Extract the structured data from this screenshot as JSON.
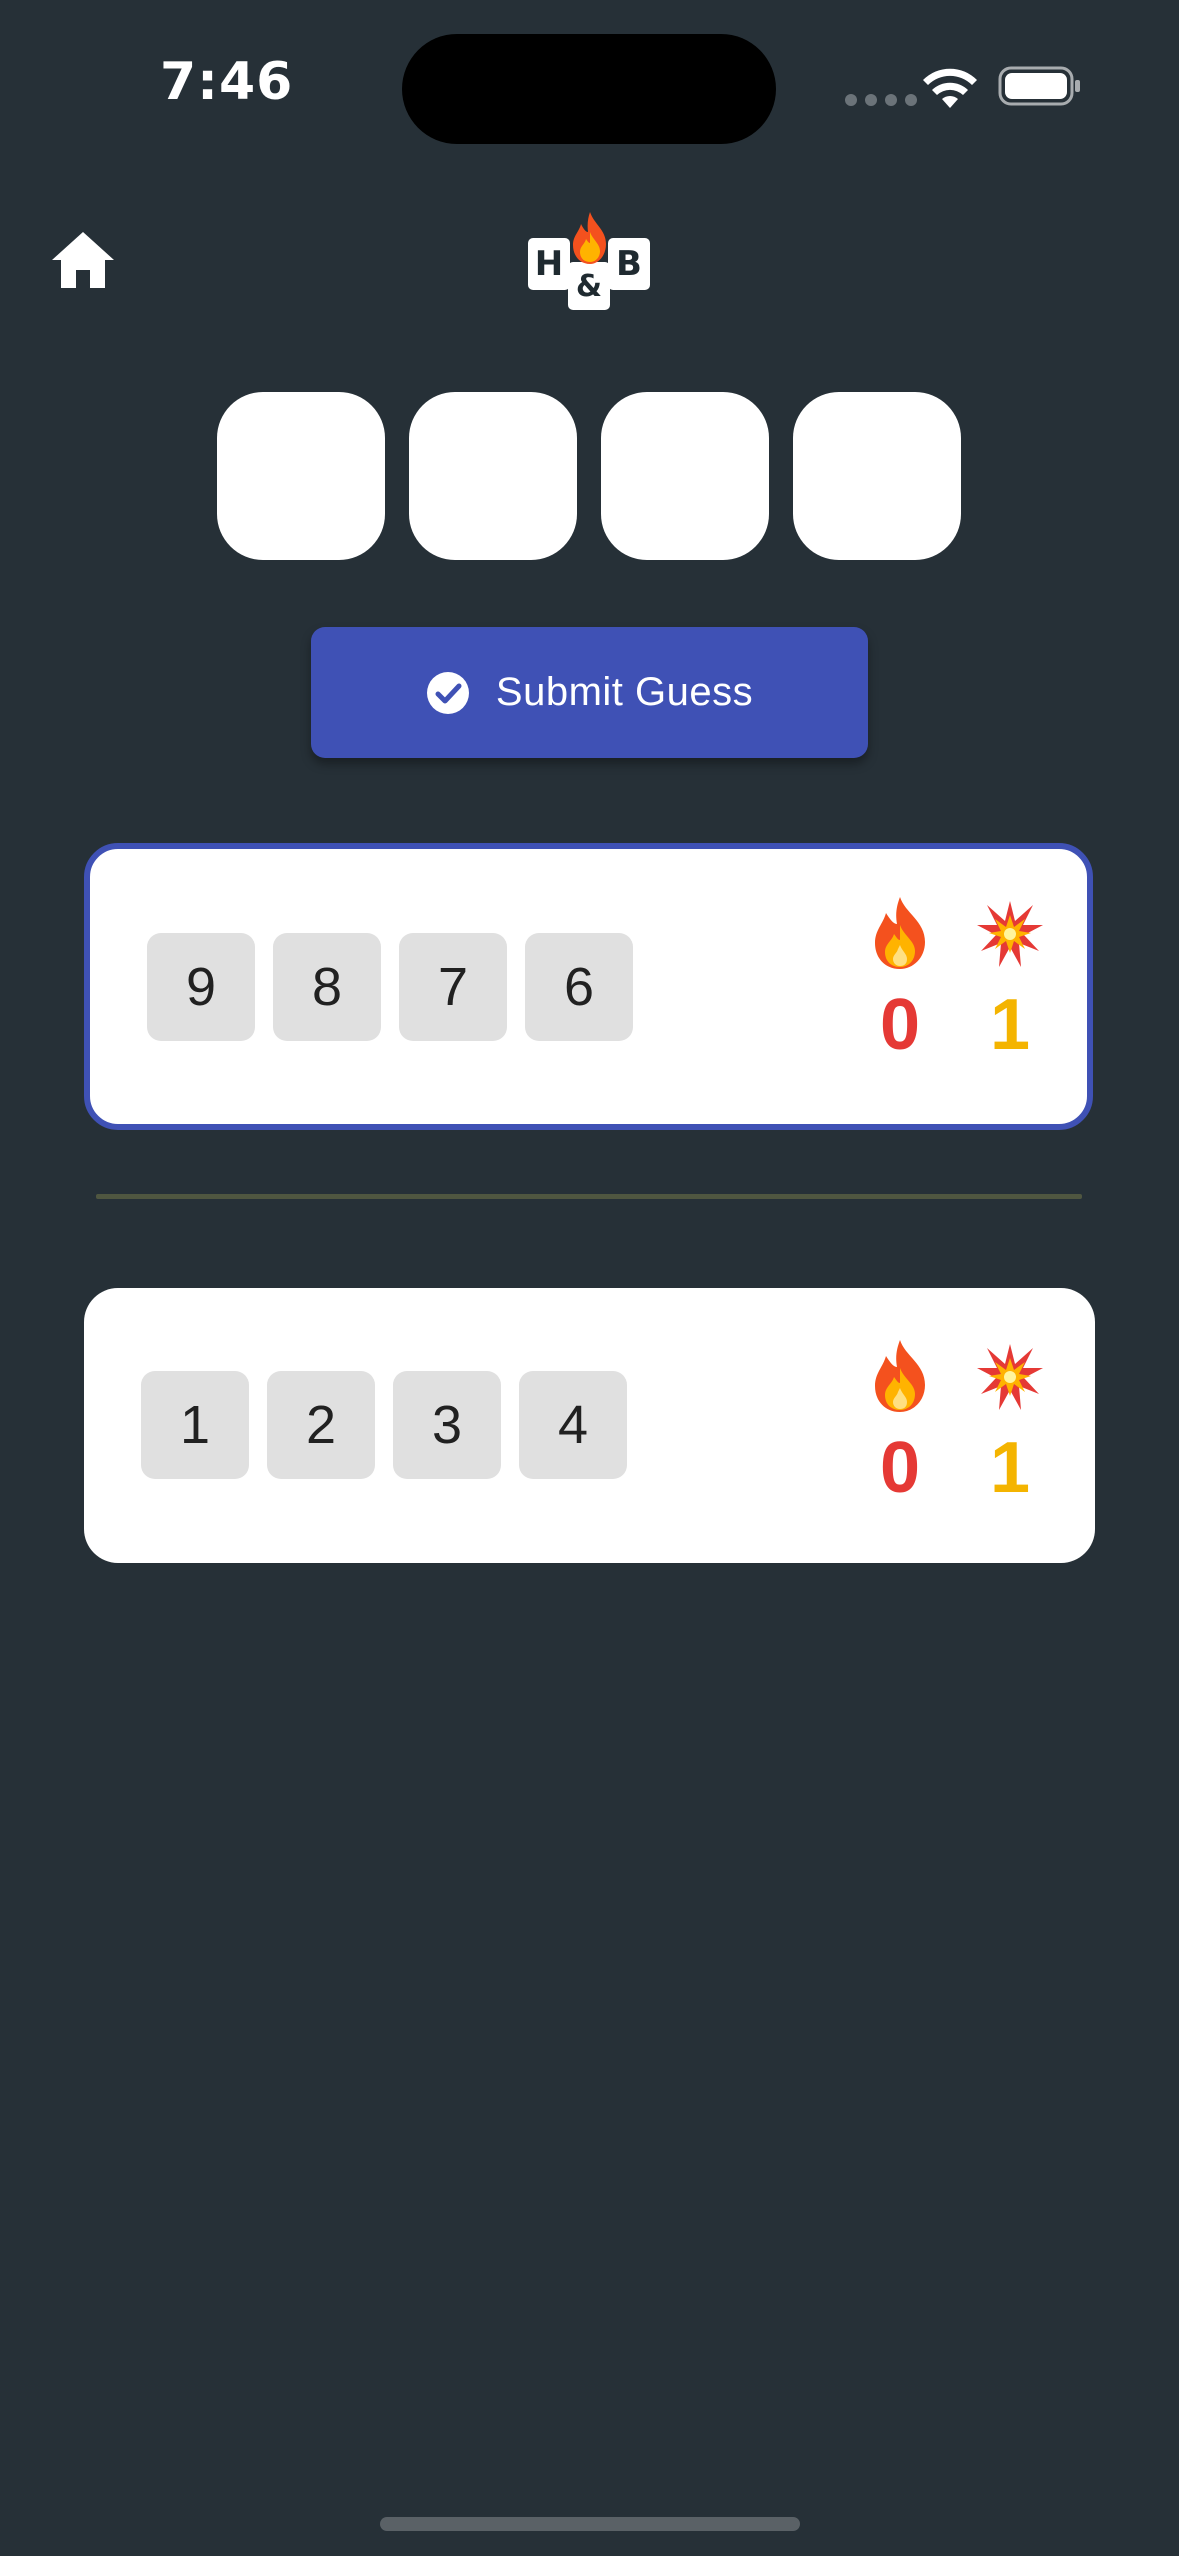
{
  "status_bar": {
    "time": "7:46"
  },
  "header": {
    "home_icon": "home-icon",
    "logo": {
      "letter_left": "H",
      "letter_middle": "&",
      "letter_right": "B"
    }
  },
  "guess_input": {
    "values": [
      "",
      "",
      "",
      ""
    ]
  },
  "submit_button": {
    "label": "Submit Guess",
    "icon": "check-circle-icon",
    "color": "#3f51b5"
  },
  "guesses": [
    {
      "digits": [
        "9",
        "8",
        "7",
        "6"
      ],
      "hot": "0",
      "blow": "1",
      "highlighted": true
    },
    {
      "digits": [
        "1",
        "2",
        "3",
        "4"
      ],
      "hot": "0",
      "blow": "1",
      "highlighted": false
    }
  ],
  "colors": {
    "background": "#263037",
    "accent": "#3f51b5",
    "hot": "#e53935",
    "blow": "#f4b400",
    "tile": "#e0e0e0"
  }
}
